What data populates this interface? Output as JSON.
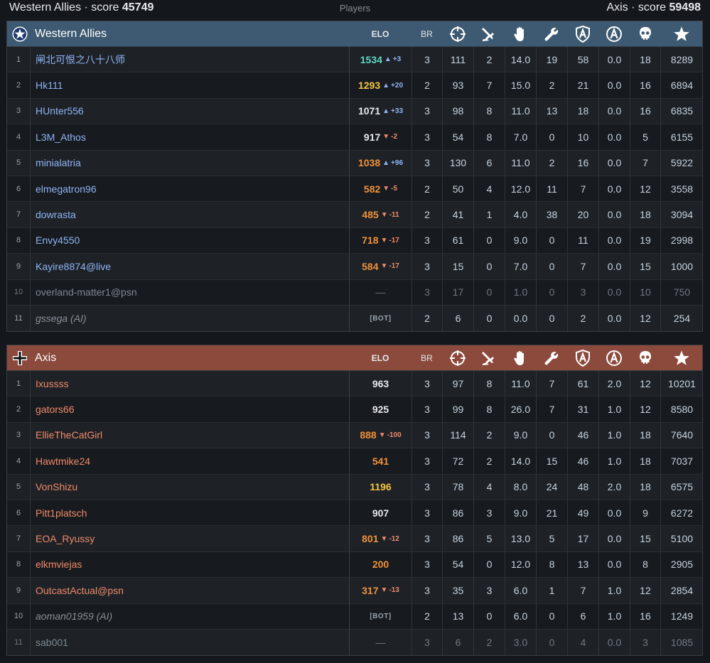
{
  "topbar": {
    "left_team": "Western Allies",
    "left_label": "score",
    "left_score": "45749",
    "center": "Players",
    "right_team": "Axis",
    "right_label": "score",
    "right_score": "59498"
  },
  "columns": {
    "elo": "ELO",
    "br": "BR",
    "icons": [
      "crosshair-icon",
      "plane-crash-icon",
      "hand-icon",
      "wrench-icon",
      "shield-a-icon",
      "circle-a-icon",
      "skull-icon",
      "star-icon"
    ]
  },
  "allies": {
    "name": "Western Allies",
    "emblem": "star-roundel-icon",
    "rows": [
      {
        "idx": "1",
        "name": "闸北可恨之八十八师",
        "elo": "1534",
        "elo_color": "#5fd6c4",
        "delta": "+3",
        "dir": "up",
        "br": "3",
        "c1": "111",
        "c2": "2",
        "c3": "14.0",
        "c4": "19",
        "c5": "58",
        "c6": "0.0",
        "c7": "18",
        "score": "8289"
      },
      {
        "idx": "2",
        "name": "Hk111",
        "elo": "1293",
        "elo_color": "#f5c542",
        "delta": "+20",
        "dir": "up",
        "br": "2",
        "c1": "93",
        "c2": "7",
        "c3": "15.0",
        "c4": "2",
        "c5": "21",
        "c6": "0.0",
        "c7": "16",
        "score": "6894"
      },
      {
        "idx": "3",
        "name": "HUnter556",
        "elo": "1071",
        "elo_color": "#e8eaed",
        "delta": "+33",
        "dir": "up",
        "br": "3",
        "c1": "98",
        "c2": "8",
        "c3": "11.0",
        "c4": "13",
        "c5": "18",
        "c6": "0.0",
        "c7": "16",
        "score": "6835"
      },
      {
        "idx": "4",
        "name": "L3M_Athos",
        "elo": "917",
        "elo_color": "#e8eaed",
        "delta": "-2",
        "dir": "down",
        "br": "3",
        "c1": "54",
        "c2": "8",
        "c3": "7.0",
        "c4": "0",
        "c5": "10",
        "c6": "0.0",
        "c7": "5",
        "score": "6155"
      },
      {
        "idx": "5",
        "name": "minialatria",
        "elo": "1038",
        "elo_color": "#f0923a",
        "delta": "+96",
        "dir": "up",
        "br": "3",
        "c1": "130",
        "c2": "6",
        "c3": "11.0",
        "c4": "2",
        "c5": "16",
        "c6": "0.0",
        "c7": "7",
        "score": "5922"
      },
      {
        "idx": "6",
        "name": "elmegatron96",
        "elo": "582",
        "elo_color": "#f0923a",
        "delta": "-5",
        "dir": "down",
        "br": "2",
        "c1": "50",
        "c2": "4",
        "c3": "12.0",
        "c4": "11",
        "c5": "7",
        "c6": "0.0",
        "c7": "12",
        "score": "3558"
      },
      {
        "idx": "7",
        "name": "dowrasta",
        "elo": "485",
        "elo_color": "#f0923a",
        "delta": "-11",
        "dir": "down",
        "br": "2",
        "c1": "41",
        "c2": "1",
        "c3": "4.0",
        "c4": "38",
        "c5": "20",
        "c6": "0.0",
        "c7": "18",
        "score": "3094"
      },
      {
        "idx": "8",
        "name": "Envy4550",
        "elo": "718",
        "elo_color": "#f0923a",
        "delta": "-17",
        "dir": "down",
        "br": "3",
        "c1": "61",
        "c2": "0",
        "c3": "9.0",
        "c4": "0",
        "c5": "11",
        "c6": "0.0",
        "c7": "19",
        "score": "2998"
      },
      {
        "idx": "9",
        "name": "Kayire8874@live",
        "elo": "584",
        "elo_color": "#f0923a",
        "delta": "-17",
        "dir": "down",
        "br": "3",
        "c1": "15",
        "c2": "0",
        "c3": "7.0",
        "c4": "0",
        "c5": "7",
        "c6": "0.0",
        "c7": "15",
        "score": "1000"
      },
      {
        "idx": "10",
        "name": "overland-matter1@psn",
        "elo": "—",
        "elo_color": "#6f7780",
        "delta": "",
        "dir": "",
        "br": "3",
        "c1": "17",
        "c2": "0",
        "c3": "1.0",
        "c4": "0",
        "c5": "3",
        "c6": "0.0",
        "c7": "10",
        "score": "750",
        "dim": true
      },
      {
        "idx": "11",
        "name": "gssega (AI)",
        "elo": "[BOT]",
        "elo_color": "#9aa3ad",
        "delta": "",
        "dir": "",
        "br": "2",
        "c1": "6",
        "c2": "0",
        "c3": "0.0",
        "c4": "0",
        "c5": "2",
        "c6": "0.0",
        "c7": "12",
        "score": "254",
        "ai": true
      }
    ]
  },
  "axis": {
    "name": "Axis",
    "emblem": "balkenkreuz-icon",
    "rows": [
      {
        "idx": "1",
        "name": "Ixussss",
        "elo": "963",
        "elo_color": "#e8eaed",
        "delta": "",
        "dir": "",
        "br": "3",
        "c1": "97",
        "c2": "8",
        "c3": "11.0",
        "c4": "7",
        "c5": "61",
        "c6": "2.0",
        "c7": "12",
        "score": "10201"
      },
      {
        "idx": "2",
        "name": "gators66",
        "elo": "925",
        "elo_color": "#e8eaed",
        "delta": "",
        "dir": "",
        "br": "3",
        "c1": "99",
        "c2": "8",
        "c3": "26.0",
        "c4": "7",
        "c5": "31",
        "c6": "1.0",
        "c7": "12",
        "score": "8580"
      },
      {
        "idx": "3",
        "name": "EllieTheCatGirl",
        "elo": "888",
        "elo_color": "#f0923a",
        "delta": "-100",
        "dir": "down",
        "br": "3",
        "c1": "114",
        "c2": "2",
        "c3": "9.0",
        "c4": "0",
        "c5": "46",
        "c6": "1.0",
        "c7": "18",
        "score": "7640"
      },
      {
        "idx": "4",
        "name": "Hawtmike24",
        "elo": "541",
        "elo_color": "#f0923a",
        "delta": "",
        "dir": "",
        "br": "3",
        "c1": "72",
        "c2": "2",
        "c3": "14.0",
        "c4": "15",
        "c5": "46",
        "c6": "1.0",
        "c7": "18",
        "score": "7037"
      },
      {
        "idx": "5",
        "name": "VonShizu",
        "elo": "1196",
        "elo_color": "#f5c542",
        "delta": "",
        "dir": "",
        "br": "3",
        "c1": "78",
        "c2": "4",
        "c3": "8.0",
        "c4": "24",
        "c5": "48",
        "c6": "2.0",
        "c7": "18",
        "score": "6575"
      },
      {
        "idx": "6",
        "name": "Pitt1platsch",
        "elo": "907",
        "elo_color": "#e8eaed",
        "delta": "",
        "dir": "",
        "br": "3",
        "c1": "86",
        "c2": "3",
        "c3": "9.0",
        "c4": "21",
        "c5": "49",
        "c6": "0.0",
        "c7": "9",
        "score": "6272"
      },
      {
        "idx": "7",
        "name": "EOA_Ryussy",
        "elo": "801",
        "elo_color": "#f0923a",
        "delta": "-12",
        "dir": "down",
        "br": "3",
        "c1": "86",
        "c2": "5",
        "c3": "13.0",
        "c4": "5",
        "c5": "17",
        "c6": "0.0",
        "c7": "15",
        "score": "5100"
      },
      {
        "idx": "8",
        "name": "elkmviejas",
        "elo": "200",
        "elo_color": "#f0923a",
        "delta": "",
        "dir": "",
        "br": "3",
        "c1": "54",
        "c2": "0",
        "c3": "12.0",
        "c4": "8",
        "c5": "13",
        "c6": "0.0",
        "c7": "8",
        "score": "2905"
      },
      {
        "idx": "9",
        "name": "OutcastActual@psn",
        "elo": "317",
        "elo_color": "#f0923a",
        "delta": "-13",
        "dir": "down",
        "br": "3",
        "c1": "35",
        "c2": "3",
        "c3": "6.0",
        "c4": "1",
        "c5": "7",
        "c6": "1.0",
        "c7": "12",
        "score": "2854"
      },
      {
        "idx": "10",
        "name": "aoman01959 (AI)",
        "elo": "[BOT]",
        "elo_color": "#9aa3ad",
        "delta": "",
        "dir": "",
        "br": "2",
        "c1": "13",
        "c2": "0",
        "c3": "6.0",
        "c4": "0",
        "c5": "6",
        "c6": "1.0",
        "c7": "16",
        "score": "1249",
        "ai": true
      },
      {
        "idx": "11",
        "name": "sab001",
        "elo": "—",
        "elo_color": "#6f7780",
        "delta": "",
        "dir": "",
        "br": "3",
        "c1": "6",
        "c2": "2",
        "c3": "3.0",
        "c4": "0",
        "c5": "4",
        "c6": "0.0",
        "c7": "3",
        "score": "1085",
        "dim": true
      }
    ]
  }
}
